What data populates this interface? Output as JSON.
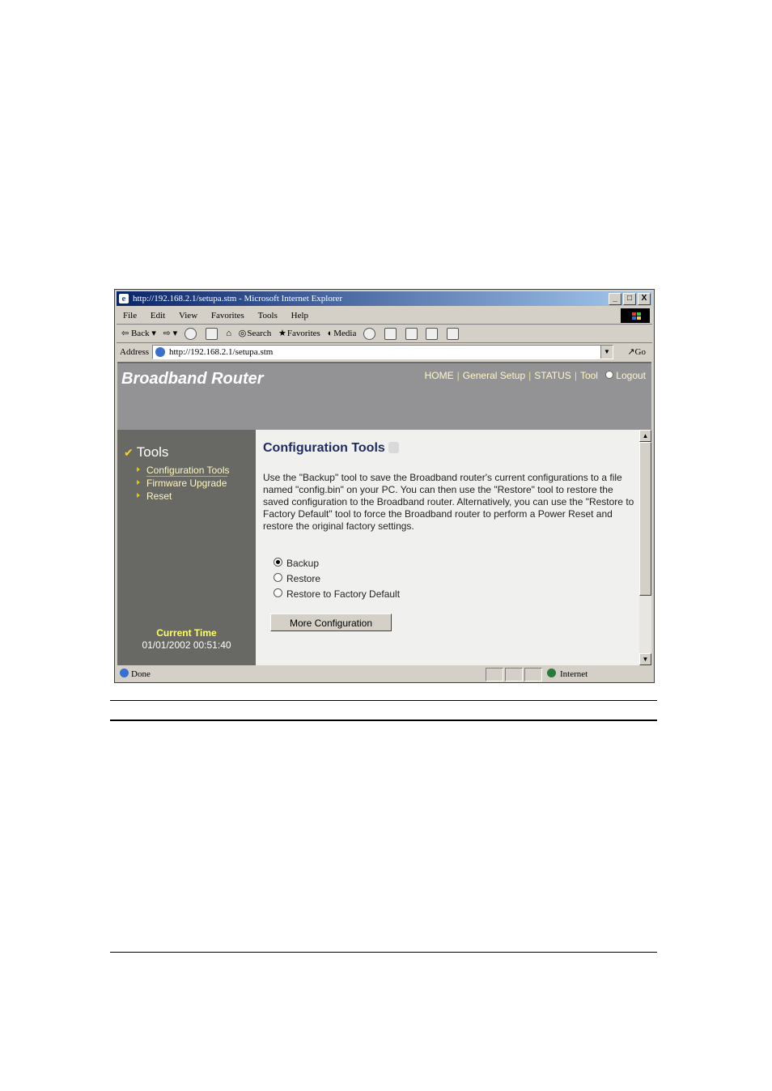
{
  "window": {
    "title": "http://192.168.2.1/setupa.stm - Microsoft Internet Explorer",
    "buttons": [
      "_",
      "□",
      "X"
    ]
  },
  "menu": [
    "File",
    "Edit",
    "View",
    "Favorites",
    "Tools",
    "Help"
  ],
  "toolbar": {
    "back": "Back",
    "search": "Search",
    "favorites": "Favorites",
    "media": "Media"
  },
  "address": {
    "label": "Address",
    "url": "http://192.168.2.1/setupa.stm",
    "go": "Go"
  },
  "router": {
    "brand": "Broadband Router",
    "nav": [
      "HOME",
      "General Setup",
      "STATUS",
      "Tool",
      "Logout"
    ],
    "sidebar": {
      "title": "Tools",
      "links": [
        "Configuration Tools",
        "Firmware Upgrade",
        "Reset"
      ],
      "current_time_label": "Current Time",
      "current_time": "01/01/2002 00:51:40"
    },
    "content": {
      "title": "Configuration Tools",
      "description": "Use the \"Backup\" tool to save the Broadband router's current configurations to a file named \"config.bin\" on your PC. You can then use the \"Restore\" tool to restore the saved configuration to the Broadband router. Alternatively, you can use the \"Restore to Factory Default\" tool to force the Broadband router to perform a Power Reset and restore the original factory settings.",
      "options": [
        "Backup",
        "Restore",
        "Restore to Factory Default"
      ],
      "selected_option": "Backup",
      "button": "More Configuration"
    }
  },
  "status": {
    "text": "Done",
    "zone": "Internet"
  }
}
